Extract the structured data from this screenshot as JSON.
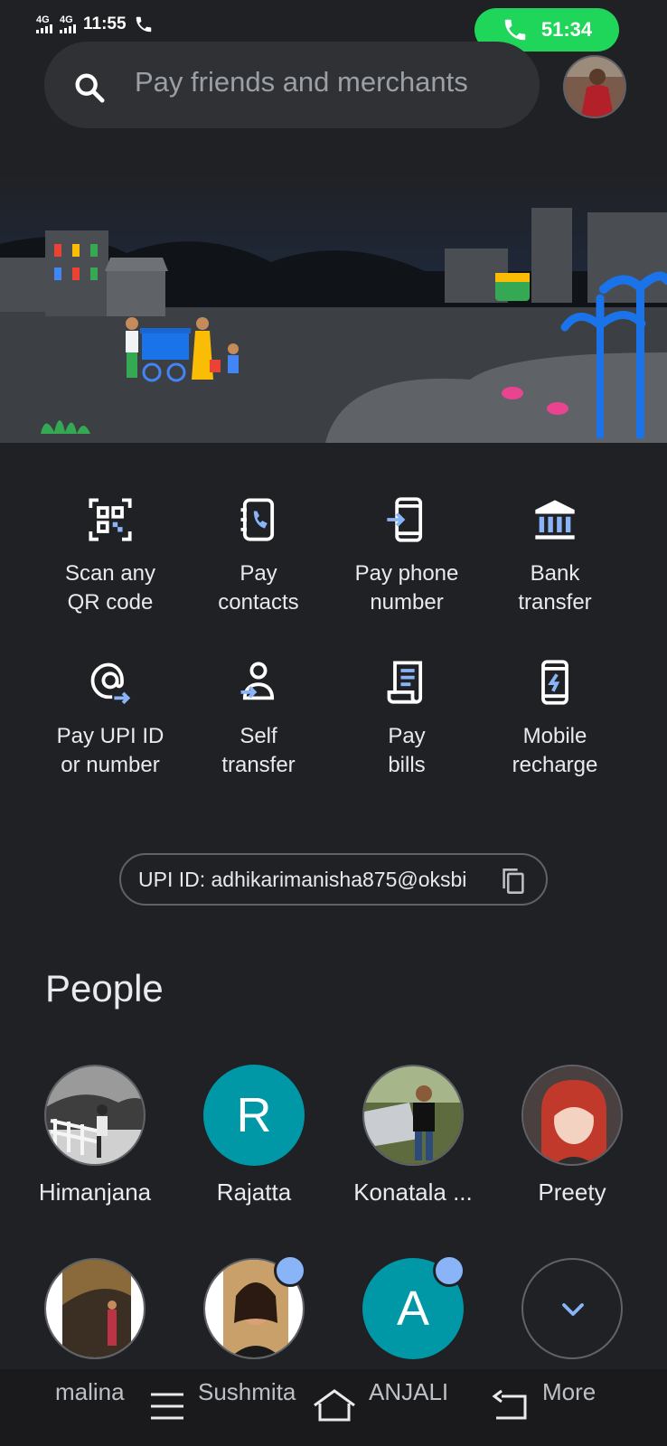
{
  "status_bar": {
    "network_1": "4G",
    "network_2": "4G",
    "time": "11:55",
    "call_timer": "51:34"
  },
  "search": {
    "placeholder": "Pay friends and merchants"
  },
  "actions": [
    {
      "line1": "Scan any",
      "line2": "QR code",
      "icon": "qr-scan-icon"
    },
    {
      "line1": "Pay",
      "line2": "contacts",
      "icon": "contacts-phone-icon"
    },
    {
      "line1": "Pay phone",
      "line2": "number",
      "icon": "phone-arrow-icon"
    },
    {
      "line1": "Bank",
      "line2": "transfer",
      "icon": "bank-icon"
    },
    {
      "line1": "Pay UPI ID",
      "line2": "or number",
      "icon": "at-sign-icon"
    },
    {
      "line1": "Self",
      "line2": "transfer",
      "icon": "self-transfer-icon"
    },
    {
      "line1": "Pay",
      "line2": "bills",
      "icon": "bill-icon"
    },
    {
      "line1": "Mobile",
      "line2": "recharge",
      "icon": "mobile-recharge-icon"
    }
  ],
  "upi": {
    "label": "UPI ID: adhikarimanisha875@oksbi"
  },
  "people": {
    "title": "People",
    "row1": [
      {
        "name": "Himanjana"
      },
      {
        "name": "Rajatta",
        "initial": "R"
      },
      {
        "name": "Konatala ..."
      },
      {
        "name": "Preety"
      }
    ],
    "row2": [
      {
        "name": "malina"
      },
      {
        "name": "Sushmita"
      },
      {
        "name": "ANJALI",
        "initial": "A"
      },
      {
        "name": "More"
      }
    ]
  },
  "colors": {
    "background": "#202124",
    "accent_blue": "#8ab4f8",
    "avatar_teal": "#0097a7",
    "call_green": "#1fd65a"
  }
}
